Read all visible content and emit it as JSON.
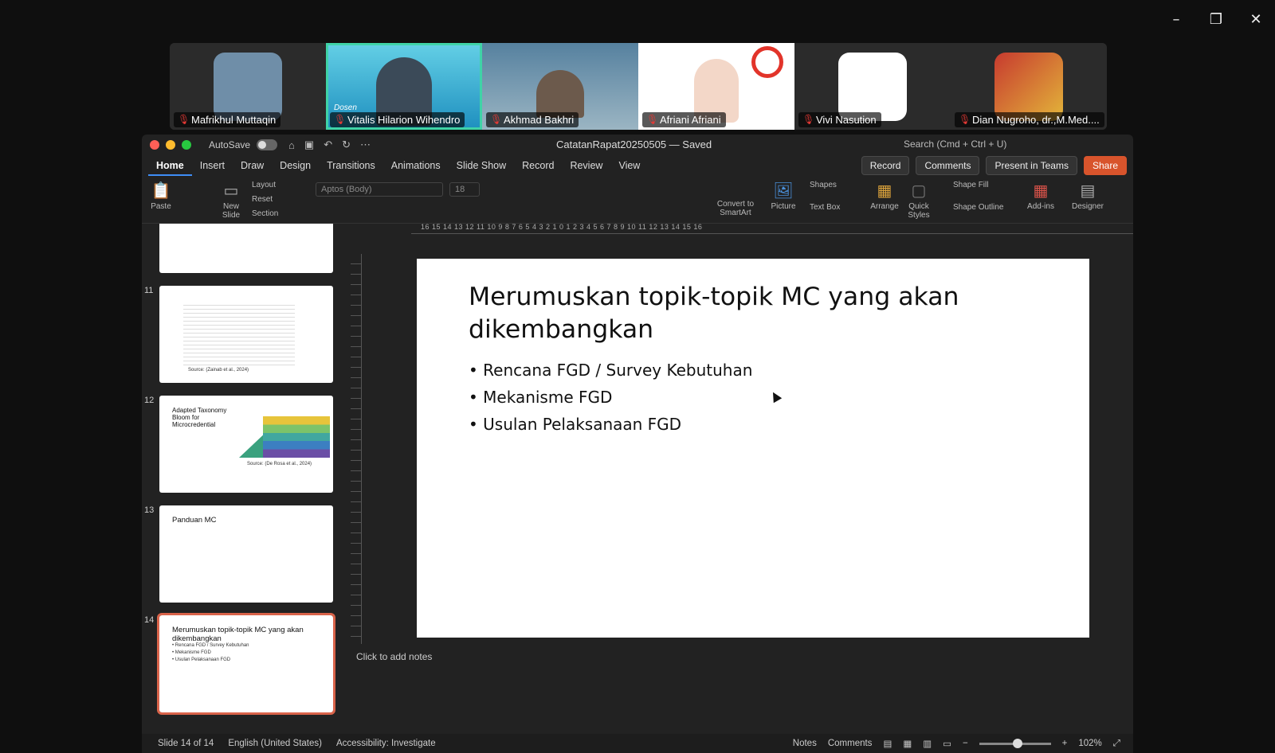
{
  "participants": [
    {
      "name": "Mafrikhul Muttaqin",
      "avatar_color": "#6f8ea8"
    },
    {
      "name": "Vitalis Hilarion Wihendro",
      "avatar_color": "#4bb9d6",
      "badge": "Dosen",
      "active": true
    },
    {
      "name": "Akhmad Bakhri",
      "avatar_color": "#6f8fa3"
    },
    {
      "name": "Afriani Afriani",
      "avatar_color": "#f3d7c8"
    },
    {
      "name": "Vivi Nasution",
      "avatar_color": "#ffffff"
    },
    {
      "name": "Dian Nugroho, dr.,M.Med....",
      "avatar_color": "#c73a2f"
    }
  ],
  "app": {
    "autosave": "AutoSave",
    "doc_title": "CatatanRapat20250505 — Saved",
    "search": "Search (Cmd + Ctrl + U)",
    "tabs": [
      "Home",
      "Insert",
      "Draw",
      "Design",
      "Transitions",
      "Animations",
      "Slide Show",
      "Record",
      "Review",
      "View"
    ],
    "selected_tab": "Home",
    "buttons": {
      "record": "Record",
      "comments": "Comments",
      "present": "Present in Teams",
      "share": "Share"
    },
    "ribbon": {
      "paste": "Paste",
      "new_slide": "New Slide",
      "layout": "Layout",
      "reset": "Reset",
      "section": "Section",
      "font": "Aptos (Body)",
      "size": "18",
      "convert": "Convert to SmartArt",
      "picture": "Picture",
      "shapes": "Shapes",
      "text_box": "Text Box",
      "arrange": "Arrange",
      "quick_styles": "Quick Styles",
      "shape_fill": "Shape Fill",
      "shape_outline": "Shape Outline",
      "addins": "Add-ins",
      "designer": "Designer"
    },
    "ruler_text": "16  15  14  13  12  11  10  9  8  7  6  5  4  3  2  1  0  1  2  3  4  5  6  7  8  9  10  11  12  13  14  15  16",
    "thumbnails": [
      {
        "num": "11",
        "title": "",
        "source": "Source: (Zainab et al., 2024)"
      },
      {
        "num": "12",
        "title": "Adapted Taxonomy Bloom for Microcredential",
        "source": "Source: (De Rosa et al., 2024)"
      },
      {
        "num": "13",
        "title": "Panduan MC"
      },
      {
        "num": "14",
        "title": "Merumuskan topik-topik MC yang akan dikembangkan",
        "bullets": [
          "• Rencana FGD / Survey Kebutuhan",
          "• Mekanisme FGD",
          "• Usulan Pelaksanaan FGD"
        ]
      }
    ],
    "slide": {
      "title": "Merumuskan topik-topik MC yang akan dikembangkan",
      "bullets": [
        "Rencana FGD / Survey Kebutuhan",
        "Mekanisme FGD",
        "Usulan Pelaksanaan FGD"
      ]
    },
    "notes_placeholder": "Click to add notes",
    "status": {
      "slide": "Slide 14 of 14",
      "language": "English (United States)",
      "accessibility": "Accessibility: Investigate",
      "notes": "Notes",
      "comments": "Comments",
      "zoom": "102%"
    }
  }
}
